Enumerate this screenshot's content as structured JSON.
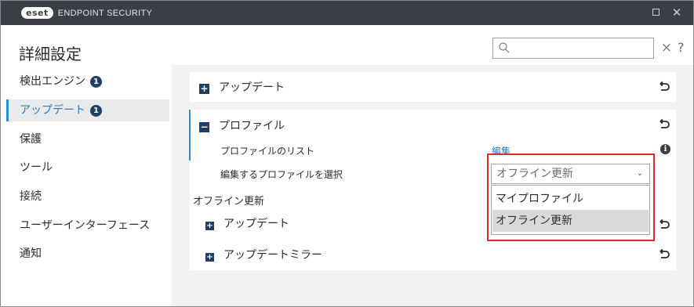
{
  "window": {
    "logo_text": "eset",
    "title": "ENDPOINT SECURITY",
    "maximize_icon": "maximize-icon",
    "close_glyph": "✕"
  },
  "header": {
    "title": "詳細設定",
    "search": {
      "value": "",
      "placeholder": ""
    },
    "clear_glyph": "×",
    "help_glyph": "?"
  },
  "sidebar": {
    "items": [
      {
        "label": "検出エンジン",
        "badge": "1",
        "active": false
      },
      {
        "label": "アップデート",
        "badge": "1",
        "active": true
      },
      {
        "label": "保護"
      },
      {
        "label": "ツール"
      },
      {
        "label": "接続"
      },
      {
        "label": "ユーザーインターフェース"
      },
      {
        "label": "通知"
      }
    ]
  },
  "main": {
    "section_update": {
      "expand_glyph": "+",
      "title": "アップデート"
    },
    "section_profile": {
      "collapse_glyph": "−",
      "title": "プロファイル",
      "profile_list_label": "プロファイルのリスト",
      "edit_link": "編集",
      "info_glyph": "i",
      "select_label": "編集するプロファイルを選択",
      "select": {
        "value": "オフライン更新",
        "options": [
          "マイプロファイル",
          "オフライン更新"
        ]
      }
    },
    "offline_label": "オフライン更新",
    "sub_update": {
      "expand_glyph": "+",
      "title": "アップデート"
    },
    "sub_mirror": {
      "expand_glyph": "+",
      "title": "アップデートミラー"
    }
  },
  "colors": {
    "titlebar": "#3a3f45",
    "accent": "#2c8fc8",
    "link": "#2c7ab8",
    "badge": "#1f3f66",
    "highlight": "#e2262a"
  }
}
